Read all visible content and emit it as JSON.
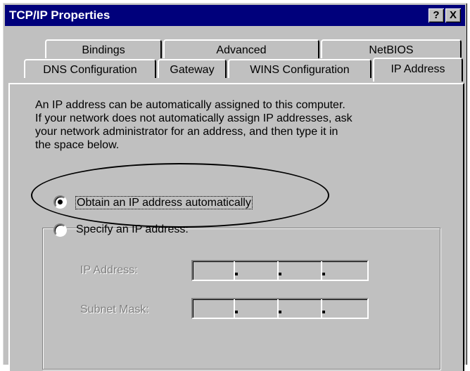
{
  "window": {
    "title": "TCP/IP Properties",
    "help_button": "?",
    "close_button": "X"
  },
  "tabs": {
    "row1": [
      "Bindings",
      "Advanced",
      "NetBIOS"
    ],
    "row2": [
      "DNS Configuration",
      "Gateway",
      "WINS Configuration",
      "IP Address"
    ],
    "active": "IP Address"
  },
  "description": {
    "line1": "An IP address can be automatically assigned to this computer.",
    "line2": "If your network does not automatically assign IP addresses, ask",
    "line3": "your network administrator for an address, and then type it in",
    "line4": "the space below."
  },
  "options": {
    "obtain_label": "Obtain an IP address automatically",
    "obtain_selected": true,
    "specify_label": "Specify an IP address:",
    "specify_selected": false
  },
  "fields": {
    "ip_label": "IP Address:",
    "subnet_label": "Subnet Mask:"
  },
  "colors": {
    "titlebar": "#00007b",
    "face": "#c0c0c0"
  }
}
